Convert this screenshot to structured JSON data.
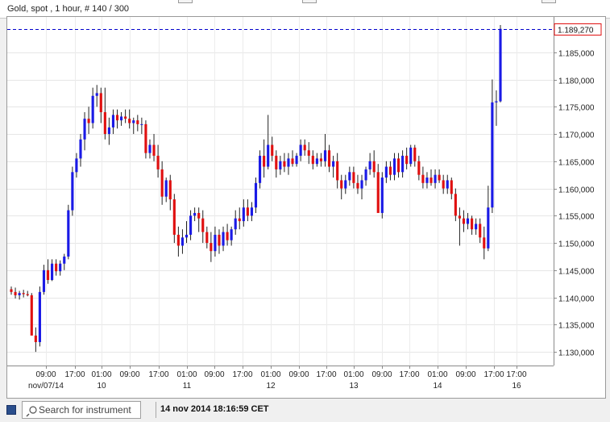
{
  "header": {
    "title": "Gold, spot , 1 hour, # 140 / 300"
  },
  "footer": {
    "search_placeholder": "Search for instrument",
    "timestamp": "14 nov 2014 18:16:59 CET"
  },
  "colors": {
    "up": "#1a1ae6",
    "down": "#e01010",
    "last_line": "#0000cc"
  },
  "chart_data": {
    "type": "candlestick",
    "title": "Gold, spot , 1 hour, # 140 / 300",
    "ylim": [
      1.1275,
      1.19
    ],
    "yticks": [
      1.13,
      1.135,
      1.14,
      1.145,
      1.15,
      1.155,
      1.16,
      1.165,
      1.17,
      1.175,
      1.18,
      1.185
    ],
    "ytick_labels": [
      "1.130,000",
      "1.135,000",
      "1.140,000",
      "1.145,000",
      "1.150,000",
      "1.155,000",
      "1.160,000",
      "1.165,000",
      "1.170,000",
      "1.175,000",
      "1.180,000",
      "1.185,000"
    ],
    "last_price": 1.18927,
    "last_price_label": "1.189,270",
    "xtick_labels": [
      "09:00",
      "17:00",
      "01:00",
      "09:00",
      "17:00",
      "01:00",
      "09:00",
      "17:00",
      "01:00",
      "09:00",
      "17:00",
      "01:00",
      "09:00",
      "17:00",
      "01:00",
      "09:00",
      "17:00",
      "17:00"
    ],
    "date_labels": [
      "nov/07/14",
      "10",
      "11",
      "12",
      "13",
      "14",
      "16"
    ],
    "grid": true,
    "ohlc": [
      [
        1.1415,
        1.142,
        1.1405,
        1.141
      ],
      [
        1.141,
        1.1418,
        1.1398,
        1.1404
      ],
      [
        1.1404,
        1.1412,
        1.1396,
        1.1408
      ],
      [
        1.1408,
        1.1414,
        1.14,
        1.1406
      ],
      [
        1.1406,
        1.1412,
        1.1402,
        1.1404
      ],
      [
        1.1404,
        1.1408,
        1.138,
        1.133
      ],
      [
        1.133,
        1.1345,
        1.13,
        1.1318
      ],
      [
        1.1318,
        1.142,
        1.131,
        1.141
      ],
      [
        1.141,
        1.146,
        1.1405,
        1.145
      ],
      [
        1.145,
        1.147,
        1.1425,
        1.1432
      ],
      [
        1.1432,
        1.147,
        1.143,
        1.1462
      ],
      [
        1.1462,
        1.147,
        1.144,
        1.1448
      ],
      [
        1.1448,
        1.1468,
        1.144,
        1.1462
      ],
      [
        1.1462,
        1.148,
        1.145,
        1.1475
      ],
      [
        1.1475,
        1.157,
        1.147,
        1.156
      ],
      [
        1.156,
        1.164,
        1.155,
        1.163
      ],
      [
        1.163,
        1.1665,
        1.162,
        1.1655
      ],
      [
        1.1655,
        1.17,
        1.164,
        1.169
      ],
      [
        1.169,
        1.174,
        1.167,
        1.1728
      ],
      [
        1.1728,
        1.175,
        1.17,
        1.172
      ],
      [
        1.172,
        1.1785,
        1.171,
        1.177
      ],
      [
        1.177,
        1.179,
        1.175,
        1.1775
      ],
      [
        1.1775,
        1.1785,
        1.172,
        1.174
      ],
      [
        1.174,
        1.1785,
        1.169,
        1.17
      ],
      [
        1.17,
        1.173,
        1.168,
        1.1712
      ],
      [
        1.1712,
        1.1745,
        1.17,
        1.1735
      ],
      [
        1.1735,
        1.1745,
        1.171,
        1.1725
      ],
      [
        1.1725,
        1.174,
        1.1715,
        1.1732
      ],
      [
        1.1732,
        1.1745,
        1.172,
        1.1728
      ],
      [
        1.1728,
        1.1745,
        1.171,
        1.172
      ],
      [
        1.172,
        1.173,
        1.17,
        1.1725
      ],
      [
        1.1725,
        1.1735,
        1.1705,
        1.1718
      ],
      [
        1.1718,
        1.173,
        1.17,
        1.1718
      ],
      [
        1.1718,
        1.1725,
        1.1655,
        1.1665
      ],
      [
        1.1665,
        1.169,
        1.1655,
        1.168
      ],
      [
        1.168,
        1.17,
        1.165,
        1.166
      ],
      [
        1.166,
        1.168,
        1.162,
        1.1635
      ],
      [
        1.1635,
        1.165,
        1.157,
        1.1585
      ],
      [
        1.1585,
        1.162,
        1.1575,
        1.1615
      ],
      [
        1.1615,
        1.1625,
        1.156,
        1.158
      ],
      [
        1.158,
        1.159,
        1.15,
        1.1515
      ],
      [
        1.1515,
        1.153,
        1.1475,
        1.1495
      ],
      [
        1.1495,
        1.1525,
        1.148,
        1.151
      ],
      [
        1.151,
        1.154,
        1.15,
        1.1515
      ],
      [
        1.1515,
        1.156,
        1.1505,
        1.155
      ],
      [
        1.155,
        1.1565,
        1.154,
        1.1555
      ],
      [
        1.1555,
        1.1565,
        1.152,
        1.1545
      ],
      [
        1.1545,
        1.156,
        1.15,
        1.152
      ],
      [
        1.152,
        1.153,
        1.149,
        1.15
      ],
      [
        1.15,
        1.152,
        1.1465,
        1.1485
      ],
      [
        1.1485,
        1.153,
        1.1475,
        1.1515
      ],
      [
        1.1515,
        1.1525,
        1.148,
        1.1495
      ],
      [
        1.1495,
        1.153,
        1.1485,
        1.152
      ],
      [
        1.152,
        1.1535,
        1.1495,
        1.1505
      ],
      [
        1.1505,
        1.153,
        1.1495,
        1.1525
      ],
      [
        1.1525,
        1.156,
        1.1515,
        1.1545
      ],
      [
        1.1545,
        1.1565,
        1.1525,
        1.154
      ],
      [
        1.154,
        1.158,
        1.153,
        1.1565
      ],
      [
        1.1565,
        1.158,
        1.154,
        1.155
      ],
      [
        1.155,
        1.1575,
        1.154,
        1.1565
      ],
      [
        1.1565,
        1.162,
        1.1555,
        1.161
      ],
      [
        1.161,
        1.167,
        1.16,
        1.166
      ],
      [
        1.166,
        1.169,
        1.162,
        1.164
      ],
      [
        1.164,
        1.1735,
        1.1635,
        1.168
      ],
      [
        1.168,
        1.1695,
        1.165,
        1.166
      ],
      [
        1.166,
        1.167,
        1.162,
        1.1635
      ],
      [
        1.1635,
        1.166,
        1.1625,
        1.165
      ],
      [
        1.165,
        1.1665,
        1.163,
        1.164
      ],
      [
        1.164,
        1.1665,
        1.1625,
        1.1655
      ],
      [
        1.1655,
        1.167,
        1.164,
        1.1645
      ],
      [
        1.1645,
        1.1665,
        1.164,
        1.166
      ],
      [
        1.166,
        1.169,
        1.165,
        1.168
      ],
      [
        1.168,
        1.169,
        1.166,
        1.167
      ],
      [
        1.167,
        1.1685,
        1.1645,
        1.166
      ],
      [
        1.166,
        1.167,
        1.1635,
        1.1645
      ],
      [
        1.1645,
        1.1665,
        1.164,
        1.1655
      ],
      [
        1.1655,
        1.1665,
        1.164,
        1.165
      ],
      [
        1.165,
        1.17,
        1.164,
        1.167
      ],
      [
        1.167,
        1.168,
        1.163,
        1.164
      ],
      [
        1.164,
        1.166,
        1.162,
        1.165
      ],
      [
        1.165,
        1.1665,
        1.16,
        1.1615
      ],
      [
        1.1615,
        1.1625,
        1.158,
        1.16
      ],
      [
        1.16,
        1.1625,
        1.159,
        1.1615
      ],
      [
        1.1615,
        1.164,
        1.1605,
        1.163
      ],
      [
        1.163,
        1.164,
        1.16,
        1.161
      ],
      [
        1.161,
        1.1625,
        1.159,
        1.16
      ],
      [
        1.16,
        1.1625,
        1.158,
        1.1615
      ],
      [
        1.1615,
        1.164,
        1.1605,
        1.1635
      ],
      [
        1.1635,
        1.1665,
        1.1625,
        1.165
      ],
      [
        1.165,
        1.167,
        1.162,
        1.163
      ],
      [
        1.163,
        1.1645,
        1.159,
        1.1555
      ],
      [
        1.1555,
        1.163,
        1.1545,
        1.162
      ],
      [
        1.162,
        1.165,
        1.161,
        1.164
      ],
      [
        1.164,
        1.165,
        1.1615,
        1.1625
      ],
      [
        1.1625,
        1.1665,
        1.1615,
        1.1655
      ],
      [
        1.1655,
        1.1665,
        1.162,
        1.163
      ],
      [
        1.163,
        1.167,
        1.162,
        1.166
      ],
      [
        1.166,
        1.1675,
        1.1635,
        1.1645
      ],
      [
        1.1645,
        1.168,
        1.164,
        1.1675
      ],
      [
        1.1675,
        1.168,
        1.164,
        1.165
      ],
      [
        1.165,
        1.166,
        1.1615,
        1.1625
      ],
      [
        1.1625,
        1.164,
        1.16,
        1.161
      ],
      [
        1.161,
        1.163,
        1.16,
        1.162
      ],
      [
        1.162,
        1.1635,
        1.1605,
        1.161
      ],
      [
        1.161,
        1.1635,
        1.16,
        1.1625
      ],
      [
        1.1625,
        1.1635,
        1.161,
        1.1615
      ],
      [
        1.1615,
        1.1625,
        1.159,
        1.16
      ],
      [
        1.16,
        1.1625,
        1.159,
        1.1615
      ],
      [
        1.1615,
        1.162,
        1.158,
        1.159
      ],
      [
        1.159,
        1.16,
        1.154,
        1.155
      ],
      [
        1.155,
        1.1565,
        1.1495,
        1.1545
      ],
      [
        1.1545,
        1.156,
        1.152,
        1.1535
      ],
      [
        1.1535,
        1.1555,
        1.1525,
        1.1545
      ],
      [
        1.1545,
        1.155,
        1.1515,
        1.1525
      ],
      [
        1.1525,
        1.1545,
        1.1515,
        1.1535
      ],
      [
        1.1535,
        1.1545,
        1.15,
        1.151
      ],
      [
        1.151,
        1.153,
        1.147,
        1.149
      ],
      [
        1.149,
        1.1605,
        1.1485,
        1.1565
      ],
      [
        1.1565,
        1.18,
        1.1555,
        1.1758
      ],
      [
        1.1758,
        1.178,
        1.1715,
        1.176
      ],
      [
        1.176,
        1.19,
        1.1758,
        1.1893
      ]
    ]
  }
}
